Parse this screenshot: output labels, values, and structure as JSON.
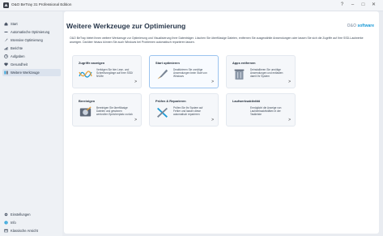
{
  "window": {
    "title": "O&O BeTray 31 Professional Edition",
    "help": "?",
    "minimize": "–",
    "maximize": "□",
    "close": "✕"
  },
  "sidebar": {
    "items": [
      {
        "label": "Start"
      },
      {
        "label": "Automatische Optimierung"
      },
      {
        "label": "Intensive Optimierung"
      },
      {
        "label": "Berichte"
      },
      {
        "label": "Aufgaben"
      },
      {
        "label": "Gesundheit"
      },
      {
        "label": "Weitere Werkzeuge"
      }
    ],
    "bottom": [
      {
        "label": "Einstellungen"
      },
      {
        "label": "Info"
      },
      {
        "label": "Klassische Ansicht"
      }
    ]
  },
  "main": {
    "title": "Weitere Werkzeuge zur Optimierung",
    "brand": {
      "oo": "O&O",
      "software": "software"
    },
    "description": "O&O BeTray bietet Ihnen weitere Werkzeuge zur Optimierung und Visualisierung Ihrer Datenträger. Löschen Sie überflüssige Dateien, entfernen Sie ausgewählte Anwendungen oder lassen Sie sich die Zugriffe auf Ihre SSD-Laufwerke anzeigen. Darüber hinaus können Sie auch Windows bei Problemen automatisch reparieren lassen.",
    "cards": [
      {
        "title": "Zugriffe anzeigen",
        "text": "Verfolgen Sie hier Lese- und Schreibvorgänge auf Ihrer SSD/ NVMe",
        "arrow": ">",
        "icon": "activity-chart-icon"
      },
      {
        "title": "Start optimieren",
        "text": "Deaktivieren Sie unnötige Anwendungen beim Start von Windows",
        "arrow": ">",
        "icon": "rocket-icon"
      },
      {
        "title": "Apps entfernen",
        "text": "Deinstallieren Sie unnötige Anwendungen und entlasten damit Ihr System",
        "arrow": ">",
        "icon": "trash-bin-icon"
      },
      {
        "title": "Bereinigen",
        "text": "Bereinigen Sie überflüssige Dateien und gewinnen wertvollen Speicherplatz zurück",
        "arrow": ">",
        "icon": "drive-cleanup-icon"
      },
      {
        "title": "Prüfen & Reparieren",
        "text": "Prüfen Sie Ihr System auf Fehler und lassen diese automatisch reparieren",
        "arrow": ">",
        "icon": "repair-tools-icon"
      },
      {
        "title": "Laufwerksaktivität",
        "text": "Ermöglicht die Anzeige von Laufwerksaktivitäten in der Taskleiste",
        "arrow": ">",
        "icon": "drive-activity-icon"
      }
    ]
  },
  "colors": {
    "accent": "#1b9ad6",
    "sidebar_bg": "#eef1f5",
    "active_bg": "#dbe3ee"
  }
}
